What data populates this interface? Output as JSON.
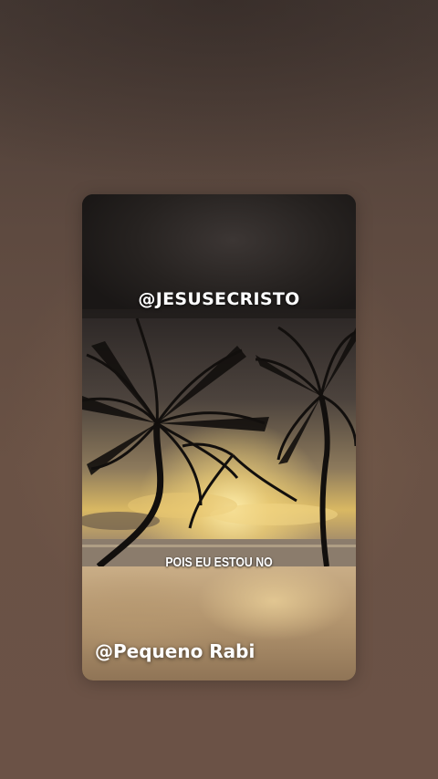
{
  "story": {
    "channel_handle": "@JESUSECRISTO",
    "caption": "POIS EU ESTOU NO",
    "author_handle": "@Pequeno Rabi"
  },
  "image": {
    "subject": "palm-trees-sunset",
    "colors": {
      "sky_glow": "#f2d37a",
      "sky_dark": "#3a3433",
      "silhouette": "#120f0d",
      "background": "#5e4a40"
    }
  }
}
